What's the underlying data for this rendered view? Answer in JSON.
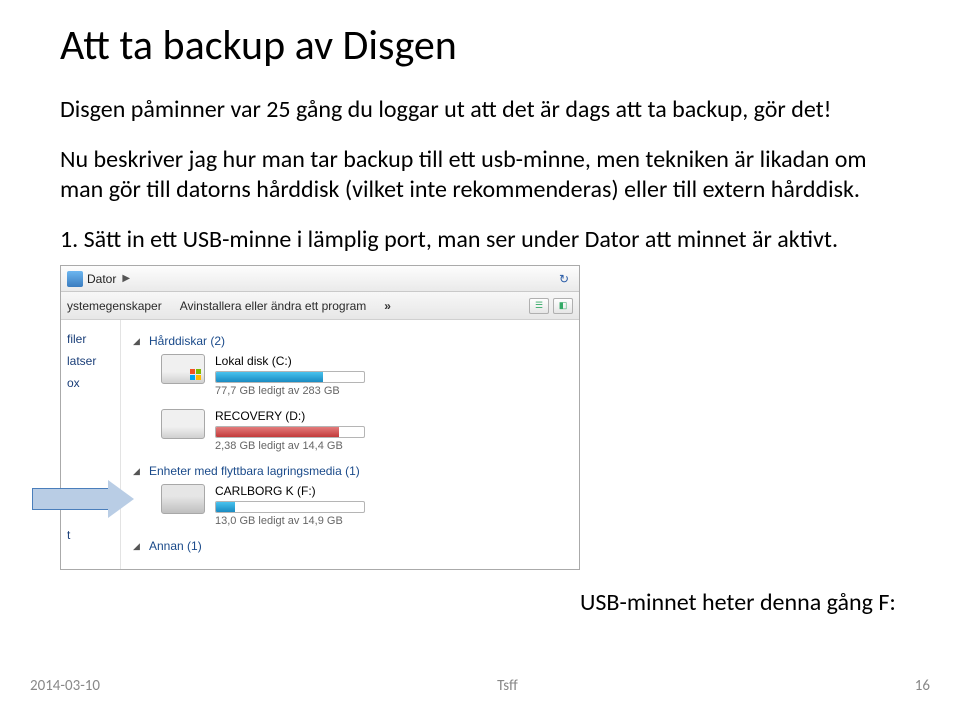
{
  "title": "Att ta backup av Disgen",
  "para1": "Disgen påminner var 25 gång du loggar ut att det är dags att ta backup, gör det!",
  "para2": "Nu beskriver jag hur man tar backup till ett usb-minne, men tekniken är likadan om man gör till datorns hårddisk (vilket inte rekommenderas) eller till extern hårddisk.",
  "step1": "1. Sätt in ett USB-minne i lämplig port, man ser under Dator att minnet är aktivt.",
  "caption": "USB-minnet heter denna gång F:",
  "explorer": {
    "breadcrumb": "Dator",
    "toolbar": {
      "item1": "ystemegenskaper",
      "item2": "Avinstallera eller ändra ett program",
      "more": "»"
    },
    "sidebar": {
      "item1": "filer",
      "item2": "latser",
      "item3": "ox",
      "item4": "t"
    },
    "groups": {
      "hdd": "Hårddiskar (2)",
      "removable": "Enheter med flyttbara lagringsmedia (1)",
      "other": "Annan (1)"
    },
    "drives": {
      "c": {
        "name": "Lokal disk (C:)",
        "info": "77,7 GB ledigt av 283 GB",
        "fill": 72
      },
      "d": {
        "name": "RECOVERY (D:)",
        "info": "2,38 GB ledigt av 14,4 GB",
        "fill": 83
      },
      "f": {
        "name": "CARLBORG K (F:)",
        "info": "13,0 GB ledigt av 14,9 GB",
        "fill": 13
      }
    }
  },
  "footer": {
    "date": "2014-03-10",
    "center": "Tsff",
    "page": "16"
  }
}
